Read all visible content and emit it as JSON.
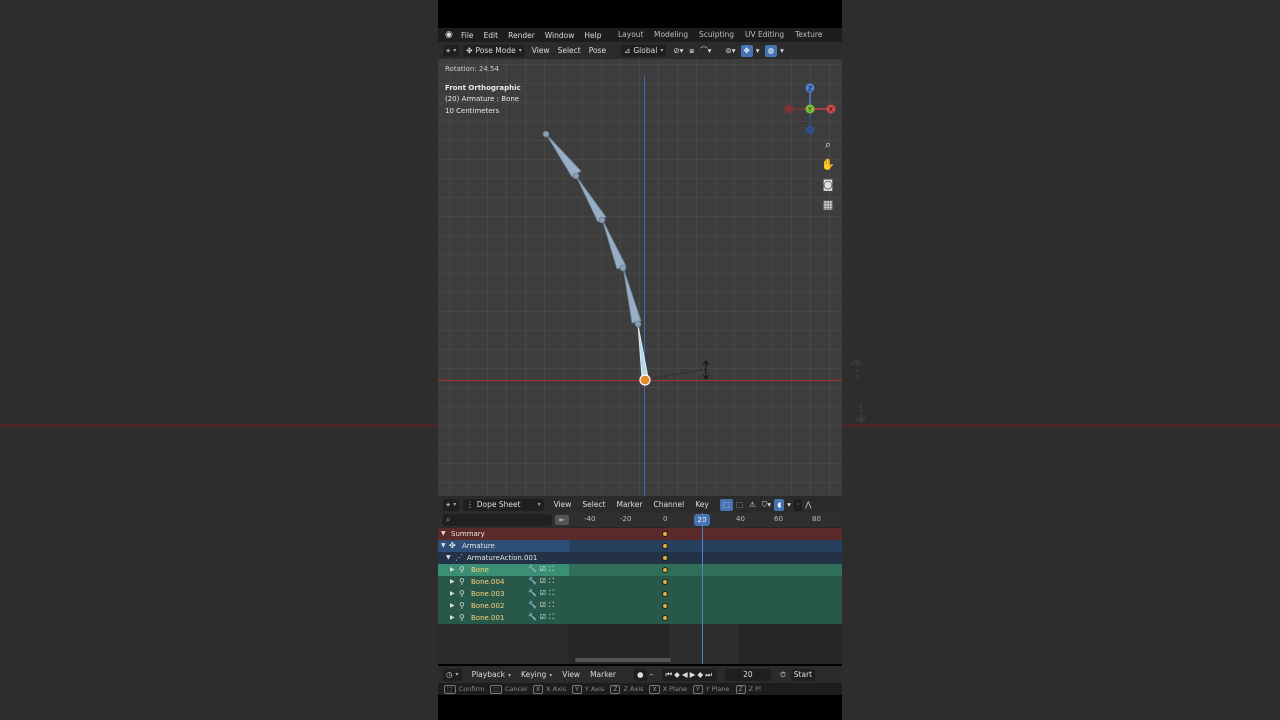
{
  "menu": [
    "File",
    "Edit",
    "Render",
    "Window",
    "Help"
  ],
  "workspaces": [
    "Layout",
    "Modeling",
    "Sculpting",
    "UV Editing",
    "Texture Paint"
  ],
  "viewport_header": {
    "mode": "Pose Mode",
    "view": "View",
    "select": "Select",
    "pose": "Pose",
    "orientation": "Global"
  },
  "viewport": {
    "operator": "Rotation: 24.54",
    "view_name": "Front Orthographic",
    "object_info": "(20) Armature : Bone",
    "scale": "10 Centimeters",
    "gizmo": {
      "z": "Z",
      "y": "Y",
      "x": "X"
    }
  },
  "dope_sheet": {
    "editor": "Dope Sheet",
    "menus": [
      "View",
      "Select",
      "Marker",
      "Channel",
      "Key"
    ],
    "ruler_ticks": [
      "-40",
      "-20",
      "0",
      "20",
      "40",
      "60",
      "80"
    ],
    "current_frame": "20",
    "channels": [
      {
        "label": "Summary",
        "kind": "summary"
      },
      {
        "label": "Armature",
        "kind": "object"
      },
      {
        "label": "ArmatureAction.001",
        "kind": "action"
      },
      {
        "label": "Bone",
        "kind": "bone-active"
      },
      {
        "label": "Bone.004",
        "kind": "bone"
      },
      {
        "label": "Bone.003",
        "kind": "bone"
      },
      {
        "label": "Bone.002",
        "kind": "bone"
      },
      {
        "label": "Bone.001",
        "kind": "bone"
      }
    ]
  },
  "timeline": {
    "playback": "Playback",
    "keying": "Keying",
    "view": "View",
    "marker": "Marker",
    "frame": "20",
    "start": "Start"
  },
  "status_bar": [
    "Confirm",
    "Cancel",
    "X Axis",
    "Y Axis",
    "Z Axis",
    "X Plane",
    "Y Plane",
    "Z Pl"
  ],
  "status_keys": [
    "X",
    "Y",
    "Z",
    "X",
    "Y",
    "Z"
  ],
  "colors": {
    "accent": "#4772b3",
    "keyframe": "#e0b33a",
    "bone_row": "#2f6f5a",
    "bone_active_row": "#3a8f74",
    "summary_row": "#5a2a2a",
    "armature_row": "#2d4f78"
  }
}
